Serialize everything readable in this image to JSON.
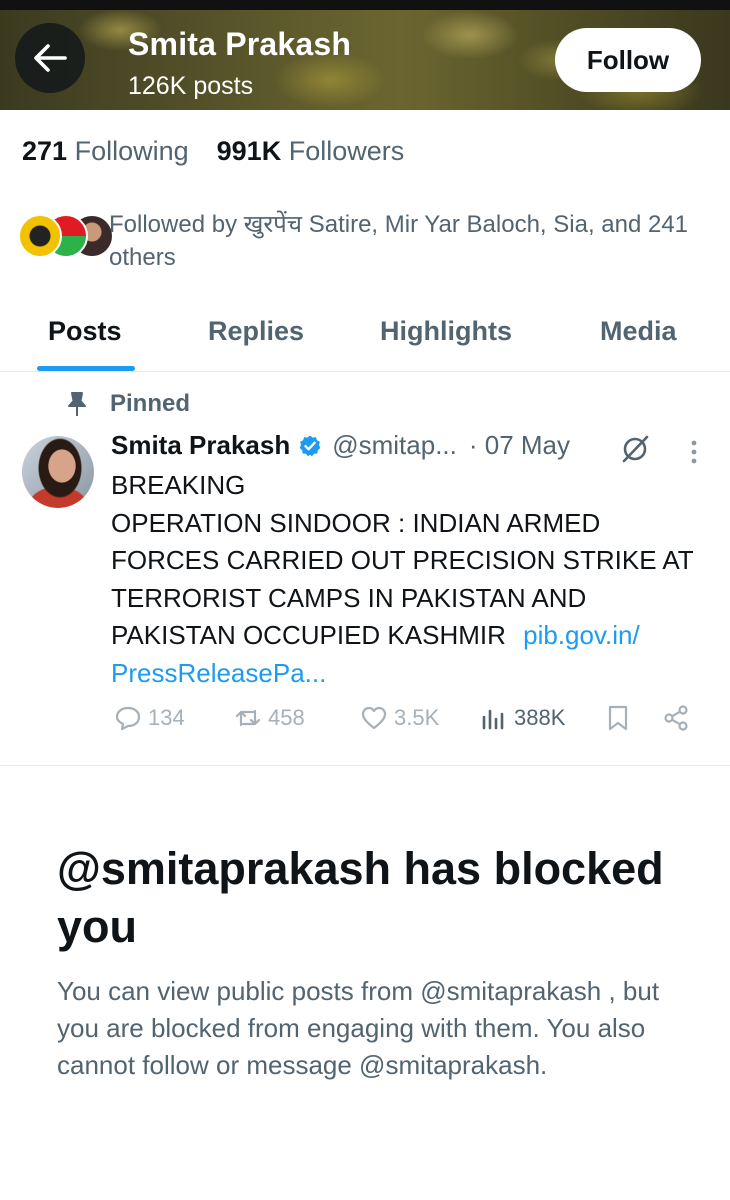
{
  "header": {
    "name": "Smita Prakash",
    "posts_count": "126K posts",
    "follow_label": "Follow"
  },
  "stats": {
    "following_count": "271",
    "following_label": "Following",
    "followers_count": "991K",
    "followers_label": "Followers"
  },
  "followed_by": {
    "text": "Followed by खुरपेंच Satire, Mir Yar Baloch, Sia, and 241 others"
  },
  "tabs": [
    {
      "label": "Posts",
      "active": true
    },
    {
      "label": "Replies",
      "active": false
    },
    {
      "label": "Highlights",
      "active": false
    },
    {
      "label": "Media",
      "active": false
    }
  ],
  "pinned_post": {
    "pinned_label": "Pinned",
    "author_name": "Smita Prakash",
    "handle": "@smitap...",
    "date": "· 07 May",
    "body_lines": [
      "BREAKING",
      "OPERATION SINDOOR : INDIAN ARMED",
      "FORCES CARRIED OUT PRECISION STRIKE AT",
      "TERRORIST CAMPS IN PAKISTAN AND"
    ],
    "body_last_line": "PAKISTAN OCCUPIED KASHMIR",
    "link_part1": "pib.gov.in/",
    "link_part2": "PressReleasePa...",
    "actions": {
      "replies": "134",
      "reposts": "458",
      "likes": "3.5K",
      "views": "388K"
    }
  },
  "blocked_notice": {
    "title": "@smitaprakash has blocked you",
    "text": "You can view public posts from @smitaprakash , but you are blocked from engaging with them. You also cannot follow or message @smitaprakash."
  },
  "colors": {
    "accent": "#1d9bf0",
    "text_primary": "#0f1419",
    "text_secondary": "#536471"
  }
}
